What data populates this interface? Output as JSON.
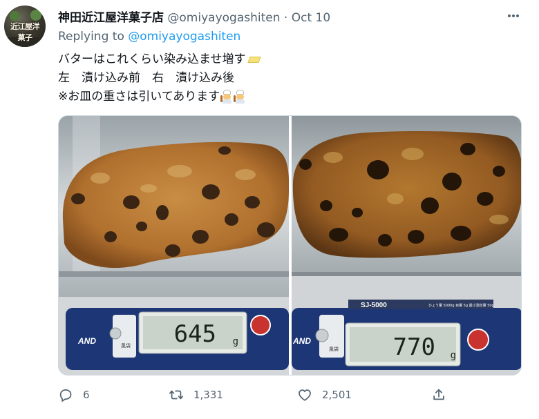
{
  "author": {
    "name": "神田近江屋洋菓子店",
    "handle": "@omiyayogashiten",
    "separator": "·",
    "date": "Oct 10",
    "avatar_text": "近江屋洋菓子"
  },
  "reply": {
    "prefix": "Replying to",
    "mention": "@omiyayogashiten"
  },
  "text": {
    "line1": "バターはこれくらい染み込ませ増す",
    "line2": "左　漬け込み前　右　漬け込み後",
    "line3": "※お皿の重さは引いてあります"
  },
  "photos": {
    "left": {
      "scale_reading": "645",
      "unit": "g",
      "brand": "AND",
      "button": "風袋"
    },
    "right": {
      "scale_reading": "770",
      "unit": "g",
      "brand": "AND",
      "model": "SJ-5000",
      "spec": "ひょう量 5000g 目量 5g 最小測定量 50g",
      "button": "風袋"
    }
  },
  "stats": {
    "replies": "6",
    "retweets": "1,331",
    "likes": "2,501"
  },
  "icons": {
    "more": "more-icon",
    "reply": "reply-icon",
    "retweet": "retweet-icon",
    "like": "heart-icon",
    "share": "share-icon"
  },
  "colors": {
    "text": "#0f1419",
    "muted": "#536471",
    "link": "#1d9bf0"
  }
}
